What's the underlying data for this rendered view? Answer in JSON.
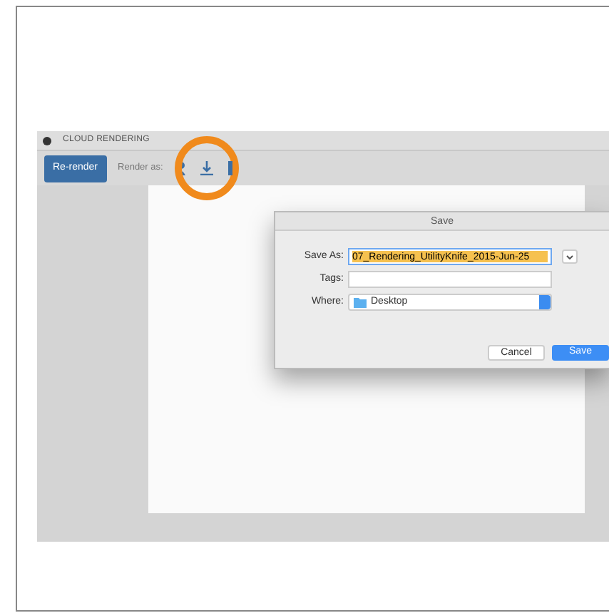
{
  "window": {
    "title": "CLOUD RENDERING"
  },
  "toolbar": {
    "primary_button": "Re-render",
    "render_label": "Render as:",
    "tools": [
      {
        "kind": "person",
        "highlighted": false
      },
      {
        "kind": "download",
        "highlighted": true
      },
      {
        "kind": "bar",
        "highlighted": false
      }
    ]
  },
  "dialog": {
    "title": "Save",
    "fields": [
      {
        "kind": "text",
        "label": "Save As:",
        "value": "07_Rendering_UtilityKnife_2015-Jun-25",
        "focused": true
      },
      {
        "kind": "text",
        "label": "Tags:",
        "focused": false
      },
      {
        "kind": "popup",
        "label": "Where:",
        "value": "Desktop",
        "focused": false
      }
    ],
    "buttons": [
      {
        "label": "Cancel",
        "default": false
      },
      {
        "label": "Save",
        "default": true
      }
    ]
  }
}
